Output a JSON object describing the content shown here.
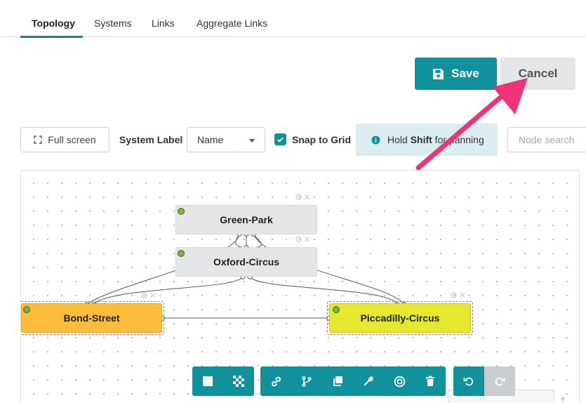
{
  "tabs": [
    {
      "label": "Topology",
      "active": true
    },
    {
      "label": "Systems",
      "active": false
    },
    {
      "label": "Links",
      "active": false
    },
    {
      "label": "Aggregate Links",
      "active": false
    }
  ],
  "actions": {
    "save_label": "Save",
    "cancel_label": "Cancel"
  },
  "toolbar": {
    "fullscreen_label": "Full screen",
    "system_label": "System Label",
    "system_label_value": "Name",
    "snap_label": "Snap to Grid",
    "snap_checked": true,
    "hint_prefix": "Hold ",
    "hint_key": "Shift",
    "hint_suffix": " for panning",
    "search_placeholder": "Node search"
  },
  "nodes": [
    {
      "label": "Green-Park",
      "status": "green"
    },
    {
      "label": "Oxford-Circus",
      "status": "green"
    },
    {
      "label": "Bond-Street",
      "status": "green"
    },
    {
      "label": "Piccadilly-Circus",
      "status": "green"
    }
  ],
  "bottom_toolbar": {
    "groups": [
      [
        "square-icon",
        "pattern-icon"
      ],
      [
        "link-icon",
        "branch-icon",
        "copy-icon",
        "wrench-icon",
        "target-icon",
        "trash-icon"
      ],
      [
        "undo-icon",
        "redo-icon"
      ]
    ]
  },
  "colors": {
    "accent": "#10919c",
    "orange_node": "#fbbd3b",
    "yellow_node": "#e6e82f",
    "status_green": "#7cb342",
    "annotation_arrow": "#f0327a"
  }
}
